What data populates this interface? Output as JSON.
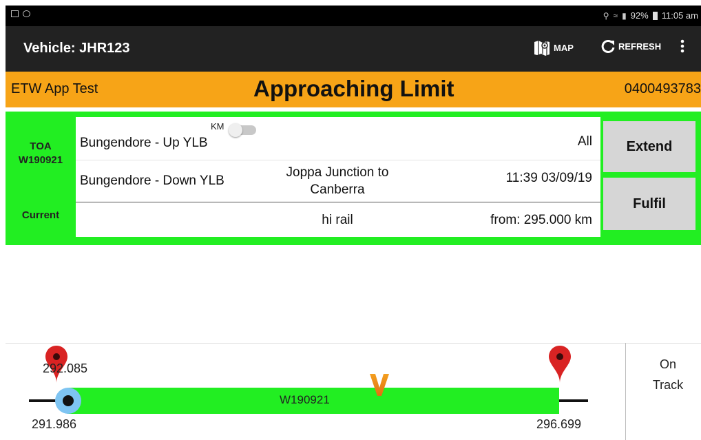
{
  "status_bar": {
    "battery": "92%",
    "time": "11:05 am"
  },
  "app_bar": {
    "title": "Vehicle: JHR123",
    "map_label": "MAP",
    "refresh_label": "REFRESH",
    "icons": [
      "map-icon",
      "refresh-icon",
      "more-vert-icon"
    ]
  },
  "banner": {
    "left_text": "ETW App Test",
    "title": "Approaching Limit",
    "phone": "0400493783",
    "color": "#f7a417"
  },
  "authority": {
    "label": "TOA",
    "id": "W190921",
    "status": "Current",
    "km_toggle_label": "KM",
    "route_up": "Bungendore - Up YLB",
    "route_down": "Bungendore - Down YLB",
    "tracks": "All",
    "section": "Joppa Junction to Canberra",
    "time": "11:39 03/09/19",
    "vehicle_type": "hi rail",
    "from": "from: 295.000 km",
    "extend_label": "Extend",
    "fulfil_label": "Fulfil",
    "color": "#22ee22"
  },
  "track": {
    "current_km": "292.085",
    "start_km": "291.986",
    "end_km": "296.699",
    "limit_label": "W190921",
    "status_text": "On Track"
  }
}
